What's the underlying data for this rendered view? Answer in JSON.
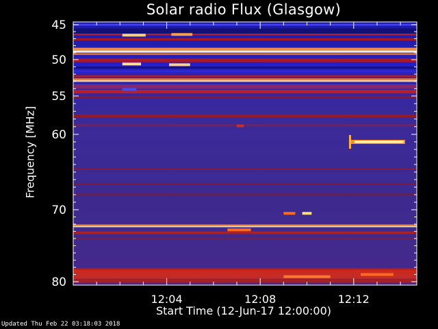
{
  "chart_data": {
    "type": "heatmap",
    "title": "Solar radio Flux (Glasgow)",
    "ylabel": "Frequency [MHz]",
    "xlabel": "Start Time (12-Jun-17 12:00:00)",
    "x_ticks": [
      "12:04",
      "12:08",
      "12:12"
    ],
    "y_ticks": [
      "45",
      "50",
      "55",
      "60",
      "70",
      "80"
    ],
    "y_tick_values": [
      45,
      50,
      55,
      60,
      70,
      80
    ],
    "x_tick_minutes": [
      4,
      8,
      12
    ],
    "xlim_minutes": [
      0,
      14.7
    ],
    "ylim_mhz": [
      44.5,
      80.5
    ],
    "colormap": "hot-on-blue",
    "features": [
      {
        "kind": "band",
        "freq_mhz": 48.9,
        "intensity": "very high"
      },
      {
        "kind": "band",
        "freq_mhz": 52.9,
        "intensity": "high"
      },
      {
        "kind": "band",
        "freq_mhz": 72.3,
        "intensity": "high"
      },
      {
        "kind": "burst",
        "t_start_min": 11.8,
        "t_end_min": 14.2,
        "freq_mhz": 61.0
      }
    ]
  },
  "footer": {
    "updated": "Updated Thu Feb 22 03:18:03 2018"
  }
}
